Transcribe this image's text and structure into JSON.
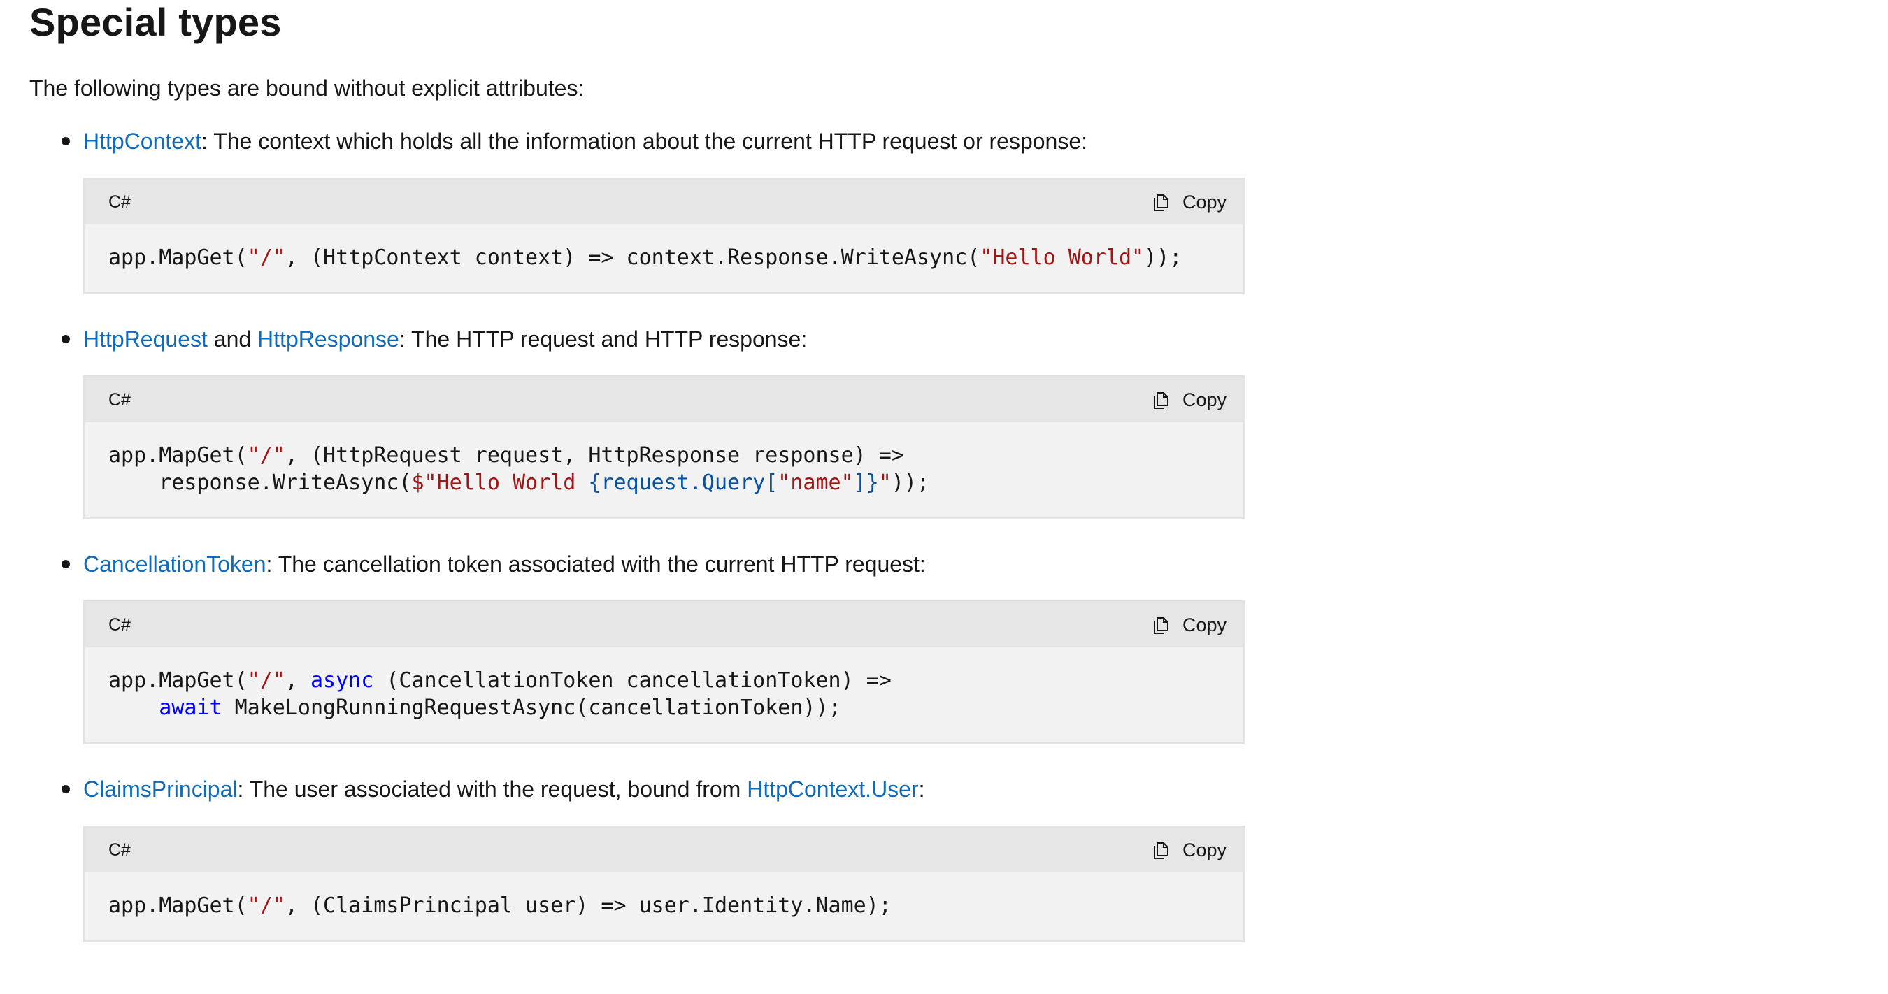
{
  "heading": "Special types",
  "intro": "The following types are bound without explicit attributes:",
  "copy_label": "Copy",
  "items": [
    {
      "link1": "HttpContext",
      "rest": ": The context which holds all the information about the current HTTP request or response:",
      "lang": "C#",
      "code": [
        [
          {
            "t": "app.MapGet(",
            "c": "plain"
          },
          {
            "t": "\"/\"",
            "c": "str"
          },
          {
            "t": ", (HttpContext context) => context.Response.WriteAsync(",
            "c": "plain"
          },
          {
            "t": "\"Hello World\"",
            "c": "str"
          },
          {
            "t": "));",
            "c": "plain"
          }
        ]
      ]
    },
    {
      "link1": "HttpRequest",
      "middle": " and ",
      "link2": "HttpResponse",
      "rest": ": The HTTP request and HTTP response:",
      "lang": "C#",
      "code": [
        [
          {
            "t": "app.MapGet(",
            "c": "plain"
          },
          {
            "t": "\"/\"",
            "c": "str"
          },
          {
            "t": ", (HttpRequest request, HttpResponse response) =>",
            "c": "plain"
          }
        ],
        [
          {
            "t": "    response.WriteAsync(",
            "c": "plain"
          },
          {
            "t": "$\"Hello World ",
            "c": "str"
          },
          {
            "t": "{request.Query[",
            "c": "interp"
          },
          {
            "t": "\"name\"",
            "c": "str"
          },
          {
            "t": "]}",
            "c": "interp"
          },
          {
            "t": "\"",
            "c": "str"
          },
          {
            "t": "));",
            "c": "plain"
          }
        ]
      ]
    },
    {
      "link1": "CancellationToken",
      "rest": ": The cancellation token associated with the current HTTP request:",
      "lang": "C#",
      "code": [
        [
          {
            "t": "app.MapGet(",
            "c": "plain"
          },
          {
            "t": "\"/\"",
            "c": "str"
          },
          {
            "t": ", ",
            "c": "plain"
          },
          {
            "t": "async",
            "c": "kw"
          },
          {
            "t": " (CancellationToken cancellationToken) =>",
            "c": "plain"
          }
        ],
        [
          {
            "t": "    ",
            "c": "plain"
          },
          {
            "t": "await",
            "c": "kw"
          },
          {
            "t": " MakeLongRunningRequestAsync(cancellationToken));",
            "c": "plain"
          }
        ]
      ]
    },
    {
      "link1": "ClaimsPrincipal",
      "rest": ": The user associated with the request, bound from ",
      "link2": "HttpContext.User",
      "tail": ":",
      "lang": "C#",
      "code": [
        [
          {
            "t": "app.MapGet(",
            "c": "plain"
          },
          {
            "t": "\"/\"",
            "c": "str"
          },
          {
            "t": ", (ClaimsPrincipal user) => user.Identity.Name);",
            "c": "plain"
          }
        ]
      ]
    }
  ]
}
